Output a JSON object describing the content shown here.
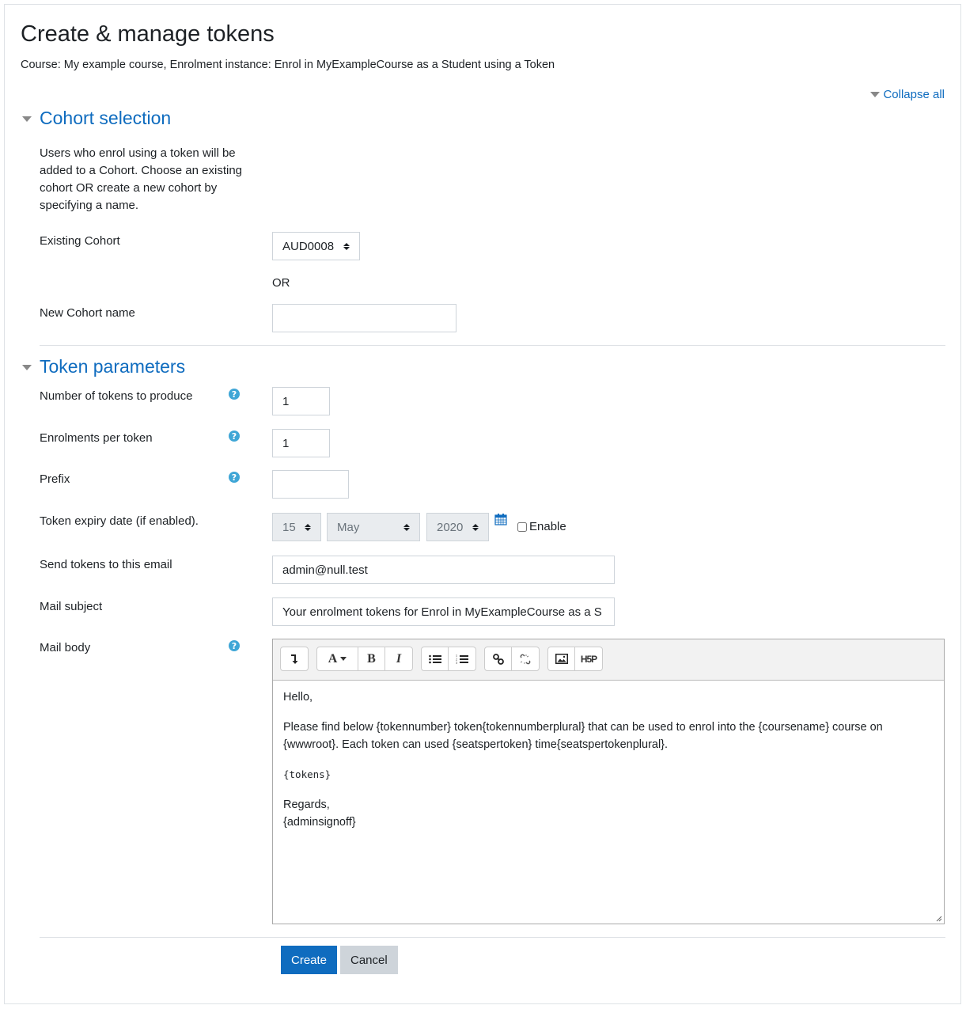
{
  "page": {
    "title": "Create & manage tokens",
    "subtitle": "Course: My example course, Enrolment instance: Enrol in MyExampleCourse as a Student using a Token",
    "collapse_all": "Collapse all"
  },
  "cohort_section": {
    "title": "Cohort selection",
    "description": "Users who enrol using a token will be added to a Cohort. Choose an existing cohort OR create a new cohort by specifying a name.",
    "existing_cohort_label": "Existing Cohort",
    "existing_cohort_value": "AUD0008",
    "or_text": "OR",
    "new_cohort_label": "New Cohort name",
    "new_cohort_value": ""
  },
  "token_section": {
    "title": "Token parameters",
    "fields": {
      "num_tokens": {
        "label": "Number of tokens to produce",
        "value": "1",
        "help_icon": "question-circle"
      },
      "enrolments_per_token": {
        "label": "Enrolments per token",
        "value": "1",
        "help_icon": "question-circle"
      },
      "prefix": {
        "label": "Prefix",
        "value": "",
        "help_icon": "question-circle"
      },
      "expiry": {
        "label": "Token expiry date (if enabled).",
        "day": "15",
        "month": "May",
        "year": "2020",
        "calendar_icon": "calendar",
        "enable_label": "Enable",
        "enabled": false
      },
      "email": {
        "label": "Send tokens to this email",
        "value": "admin@null.test"
      },
      "subject": {
        "label": "Mail subject",
        "value": "Your enrolment tokens for Enrol in MyExampleCourse as a S"
      },
      "body": {
        "label": "Mail body",
        "help_icon": "question-circle",
        "toolbar": [
          "collapse",
          "font-style",
          "bold",
          "italic",
          "unordered-list",
          "ordered-list",
          "link",
          "unlink",
          "image",
          "h5p"
        ],
        "toolbar_labels": {
          "font": "A",
          "bold": "B",
          "italic": "I",
          "h5p": "H5P"
        },
        "content": {
          "greeting": "Hello,",
          "paragraph": "Please find below {tokennumber} token{tokennumberplural} that can be used to enrol into the {coursename} course on {wwwroot}. Each token can used {seatspertoken} time{seatspertokenplural}.",
          "tokens": "{tokens}",
          "regards": "Regards,",
          "signoff": "{adminsignoff}"
        }
      }
    }
  },
  "actions": {
    "create": "Create",
    "cancel": "Cancel"
  },
  "colors": {
    "link": "#0f6cbf",
    "primary_button": "#0f6cbf",
    "secondary_button": "#ced4da",
    "help_icon": "#3fa6d6"
  }
}
